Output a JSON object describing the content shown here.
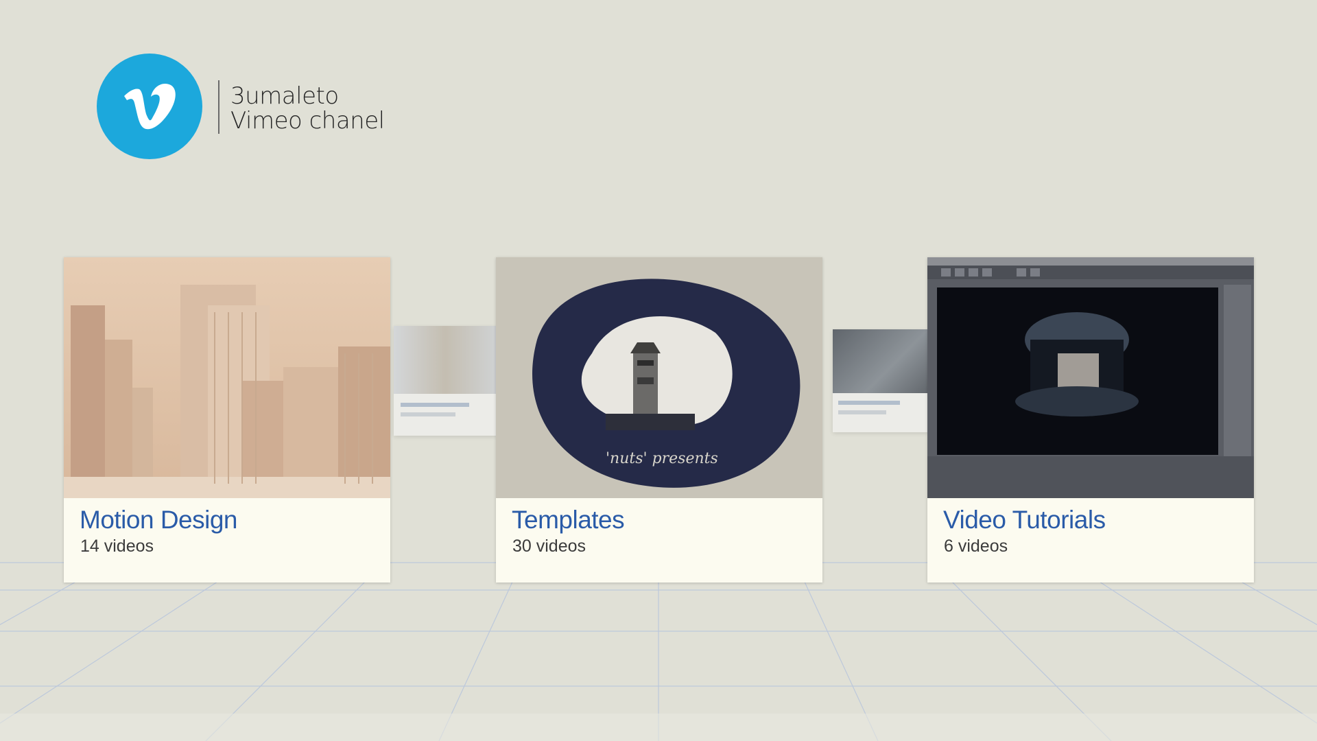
{
  "channel": {
    "logo_icon": "vimeo-logo-icon",
    "line1": "3umaleto",
    "line2": "Vimeo chanel",
    "brand_color": "#1ca8dc"
  },
  "albums": [
    {
      "title": "Motion Design",
      "count": "14 videos",
      "thumb_icon": "city-buildings-thumbnail"
    },
    {
      "title": "Templates",
      "count": "30 videos",
      "thumb_icon": "lighthouse-ink-thumbnail",
      "thumb_caption": "'nuts' presents"
    },
    {
      "title": "Video Tutorials",
      "count": "6 videos",
      "thumb_icon": "3d-software-thumbnail"
    }
  ],
  "colors": {
    "title": "#2a5ba8",
    "card": "#fcfbf0",
    "background": "#e0e0d6"
  }
}
